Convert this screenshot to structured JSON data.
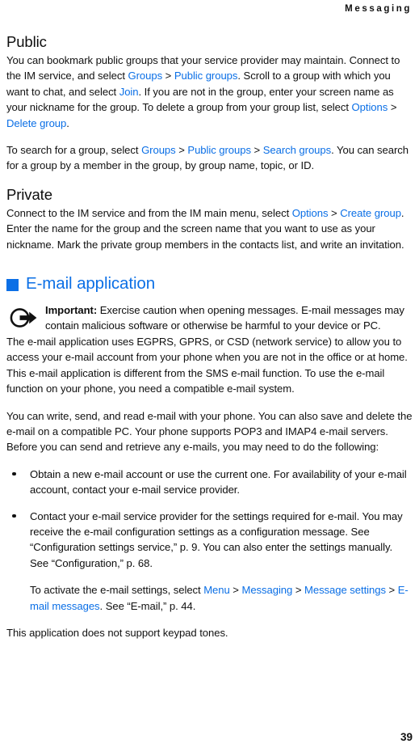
{
  "header": {
    "running_title": "Messaging"
  },
  "sections": [
    {
      "heading": "Public",
      "paragraphs": [
        {
          "runs": [
            {
              "t": "You can bookmark public groups that your service provider may maintain. Connect to the IM service, and select ",
              "s": "plain"
            },
            {
              "t": "Groups",
              "s": "link"
            },
            {
              "t": " > ",
              "s": "plain"
            },
            {
              "t": "Public groups",
              "s": "link"
            },
            {
              "t": ". Scroll to a group with which you want to chat, and select ",
              "s": "plain"
            },
            {
              "t": "Join",
              "s": "link"
            },
            {
              "t": ". If you are not in the group, enter your screen name as your nickname for the group. To delete a group from your group list, select ",
              "s": "plain"
            },
            {
              "t": "Options",
              "s": "link"
            },
            {
              "t": " > ",
              "s": "plain"
            },
            {
              "t": "Delete group",
              "s": "link"
            },
            {
              "t": ".",
              "s": "plain"
            }
          ]
        },
        {
          "runs": [
            {
              "t": "To search for a group, select ",
              "s": "plain"
            },
            {
              "t": "Groups",
              "s": "link"
            },
            {
              "t": " > ",
              "s": "plain"
            },
            {
              "t": "Public groups",
              "s": "link"
            },
            {
              "t": " > ",
              "s": "plain"
            },
            {
              "t": "Search groups",
              "s": "link"
            },
            {
              "t": ". You can search for a group by a member in the group, by group name, topic, or ID.",
              "s": "plain"
            }
          ]
        }
      ]
    },
    {
      "heading": "Private",
      "paragraphs": [
        {
          "runs": [
            {
              "t": "Connect to the IM service and from the IM main menu, select ",
              "s": "plain"
            },
            {
              "t": "Options",
              "s": "link"
            },
            {
              "t": " > ",
              "s": "plain"
            },
            {
              "t": "Create group",
              "s": "link"
            },
            {
              "t": ". Enter the name for the group and the screen name that you want to use as your nickname. Mark the private group members in the contacts list, and write an invitation.",
              "s": "plain"
            }
          ]
        }
      ]
    }
  ],
  "email_section": {
    "bullet_icon": "blue-square-bullet",
    "heading": "E-mail application",
    "note": {
      "icon": "important-note-icon",
      "runs": [
        {
          "t": "Important:",
          "s": "bold"
        },
        {
          "t": " Exercise caution when opening messages. E-mail messages may contain malicious software or otherwise be harmful to your device or PC.",
          "s": "plain"
        }
      ]
    },
    "paragraphs": [
      {
        "runs": [
          {
            "t": "The e-mail application uses EGPRS, GPRS, or CSD (network service) to allow you to access your e-mail account from your phone when you are not in the office or at home. This e-mail application is different from the SMS e-mail function. To use the e-mail function on your phone, you need a compatible e-mail system.",
            "s": "plain"
          }
        ]
      },
      {
        "runs": [
          {
            "t": "You can write, send, and read e-mail with your phone. You can also save and delete the e-mail on a compatible PC. Your phone supports POP3 and IMAP4 e-mail servers. Before you can send and retrieve any e-mails, you may need to do the following:",
            "s": "plain"
          }
        ]
      }
    ],
    "bullets": [
      {
        "runs": [
          {
            "t": "Obtain a new e-mail account or use the current one. For availability of your e-mail account, contact your e-mail service provider.",
            "s": "plain"
          }
        ]
      },
      {
        "runs": [
          {
            "t": "Contact your e-mail service provider for the settings required for e-mail. You may receive the e-mail configuration settings as a configuration message. See “Configuration settings service,” p. 9. You can also enter the settings manually. See “Configuration,” p. 68.",
            "s": "plain"
          }
        ]
      }
    ],
    "indented_paragraph": {
      "runs": [
        {
          "t": "To activate the e-mail settings, select ",
          "s": "plain"
        },
        {
          "t": "Menu",
          "s": "link"
        },
        {
          "t": " > ",
          "s": "plain"
        },
        {
          "t": "Messaging",
          "s": "link"
        },
        {
          "t": " > ",
          "s": "plain"
        },
        {
          "t": "Message settings",
          "s": "link"
        },
        {
          "t": " > ",
          "s": "plain"
        },
        {
          "t": "E-mail messages",
          "s": "link"
        },
        {
          "t": ". See “E-mail,” p. 44.",
          "s": "plain"
        }
      ]
    },
    "closing_paragraph": {
      "runs": [
        {
          "t": "This application does not support keypad tones.",
          "s": "plain"
        }
      ]
    }
  },
  "footer": {
    "page_number": "39"
  },
  "colors": {
    "link": "#0b6fe6",
    "heading": "#0b6fe6",
    "text": "#111111",
    "background": "#ffffff"
  }
}
